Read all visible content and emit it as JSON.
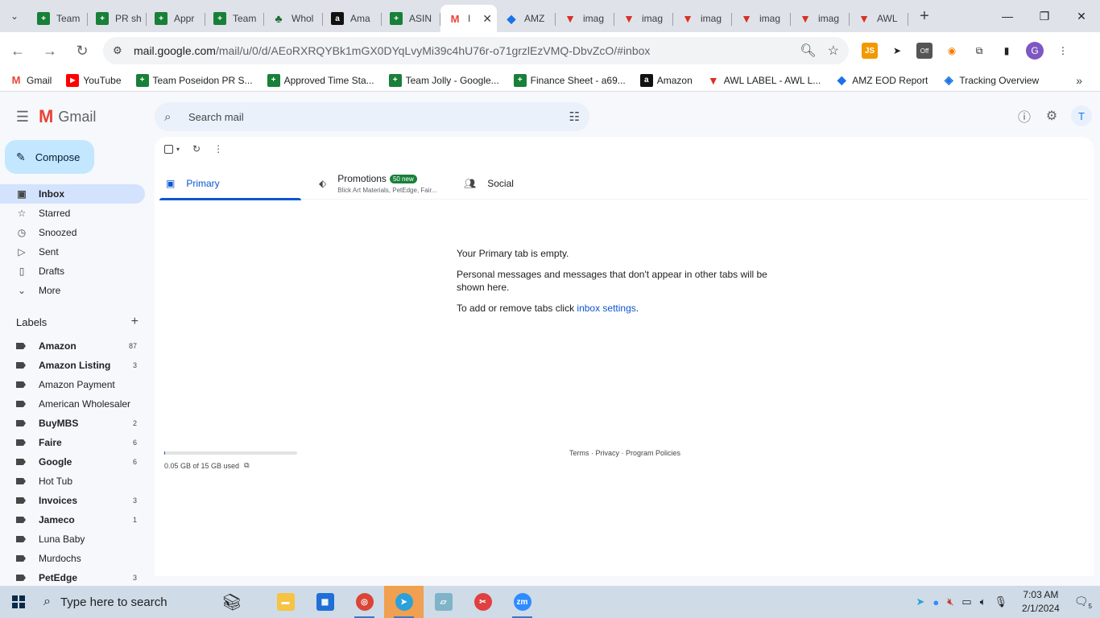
{
  "browser": {
    "tabs": [
      {
        "label": "Team",
        "icon": "sheets"
      },
      {
        "label": "PR sh",
        "icon": "sheets"
      },
      {
        "label": "Appr",
        "icon": "sheets"
      },
      {
        "label": "Team",
        "icon": "sheets"
      },
      {
        "label": "Whol",
        "icon": "leaf"
      },
      {
        "label": "Ama",
        "icon": "amazon"
      },
      {
        "label": "ASIN",
        "icon": "sheets"
      },
      {
        "label": "I",
        "icon": "gmail",
        "active": true
      },
      {
        "label": "AMZ",
        "icon": "zoho"
      },
      {
        "label": "imag",
        "icon": "red"
      },
      {
        "label": "imag",
        "icon": "red"
      },
      {
        "label": "imag",
        "icon": "red"
      },
      {
        "label": "imag",
        "icon": "red"
      },
      {
        "label": "imag",
        "icon": "red"
      },
      {
        "label": "AWL",
        "icon": "red"
      }
    ],
    "url_domain": "mail.google.com",
    "url_path": "/mail/u/0/d/AEoRXRQYBk1mGX0DYqLvyMi39c4hU76r-o71grzlEzVMQ-DbvZcO/#inbox",
    "profile_initial": "G",
    "ext_off_label": "Off",
    "bookmarks": [
      {
        "label": "Gmail",
        "icon": "gmail"
      },
      {
        "label": "YouTube",
        "icon": "youtube"
      },
      {
        "label": "Team Poseidon PR S...",
        "icon": "sheets"
      },
      {
        "label": "Approved Time Sta...",
        "icon": "sheets"
      },
      {
        "label": "Team Jolly - Google...",
        "icon": "sheets"
      },
      {
        "label": "Finance Sheet - a69...",
        "icon": "sheets"
      },
      {
        "label": "Amazon",
        "icon": "amazon"
      },
      {
        "label": "AWL LABEL - AWL L...",
        "icon": "red"
      },
      {
        "label": "AMZ EOD Report",
        "icon": "zoho"
      },
      {
        "label": "Tracking Overview",
        "icon": "tracking"
      }
    ]
  },
  "gmail": {
    "logo_text": "Gmail",
    "search_placeholder": "Search mail",
    "user_initial": "T",
    "compose_label": "Compose",
    "nav": [
      {
        "label": "Inbox",
        "icon": "inbox-icon",
        "glyph": "▣",
        "active": true
      },
      {
        "label": "Starred",
        "icon": "star-icon",
        "glyph": "☆"
      },
      {
        "label": "Snoozed",
        "icon": "clock-icon",
        "glyph": "◷"
      },
      {
        "label": "Sent",
        "icon": "send-icon",
        "glyph": "▷"
      },
      {
        "label": "Drafts",
        "icon": "draft-icon",
        "glyph": "▯"
      },
      {
        "label": "More",
        "icon": "chevron-down-icon",
        "glyph": "⌄"
      }
    ],
    "labels_title": "Labels",
    "labels": [
      {
        "name": "Amazon",
        "count": "87",
        "bold": true
      },
      {
        "name": "Amazon Listing",
        "count": "3",
        "bold": true
      },
      {
        "name": "Amazon Payment",
        "count": "",
        "bold": false
      },
      {
        "name": "American Wholesaler",
        "count": "",
        "bold": false
      },
      {
        "name": "BuyMBS",
        "count": "2",
        "bold": true
      },
      {
        "name": "Faire",
        "count": "6",
        "bold": true
      },
      {
        "name": "Google",
        "count": "6",
        "bold": true
      },
      {
        "name": "Hot Tub",
        "count": "",
        "bold": false
      },
      {
        "name": "Invoices",
        "count": "3",
        "bold": true
      },
      {
        "name": "Jameco",
        "count": "1",
        "bold": true
      },
      {
        "name": "Luna Baby",
        "count": "",
        "bold": false
      },
      {
        "name": "Murdochs",
        "count": "",
        "bold": false
      },
      {
        "name": "PetEdge",
        "count": "3",
        "bold": true
      }
    ],
    "tabs": {
      "primary": "Primary",
      "promotions": "Promotions",
      "promotions_badge": "50 new",
      "promotions_sub": "Blick Art Materials, PetEdge, Fair...",
      "social": "Social"
    },
    "empty": {
      "title": "Your Primary tab is empty.",
      "body": "Personal messages and messages that don't appear in other tabs will be shown here.",
      "settings_prefix": "To add or remove tabs click ",
      "settings_link": "inbox settings",
      "settings_suffix": "."
    },
    "storage_text": "0.05 GB of 15 GB used",
    "storage_used_fraction": 0.003,
    "footer": "Terms · Privacy · Program Policies"
  },
  "taskbar": {
    "search_placeholder": "Type here to search",
    "time": "7:03 AM",
    "date": "2/1/2024",
    "notif_count": "5",
    "apps": [
      {
        "name": "file-explorer",
        "label": ""
      },
      {
        "name": "microsoft-store",
        "label": ""
      },
      {
        "name": "chrome",
        "label": ""
      },
      {
        "name": "telegram",
        "label": ""
      },
      {
        "name": "notes-app",
        "label": ""
      },
      {
        "name": "snipping-tool",
        "label": ""
      },
      {
        "name": "zoom",
        "label": "zm"
      }
    ]
  }
}
